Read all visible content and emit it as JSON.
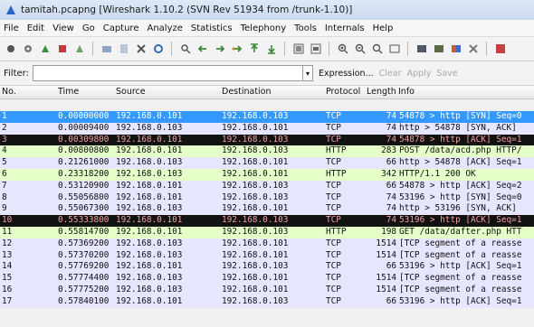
{
  "window": {
    "title": "tamitah.pcapng  [Wireshark 1.10.2  (SVN Rev 51934 from /trunk-1.10)]"
  },
  "menu": [
    "File",
    "Edit",
    "View",
    "Go",
    "Capture",
    "Analyze",
    "Statistics",
    "Telephony",
    "Tools",
    "Internals",
    "Help"
  ],
  "toolbar": {
    "icons": [
      "interface-list-icon",
      "capture-options-icon",
      "start-capture-icon",
      "stop-capture-icon",
      "restart-capture-icon",
      "open-file-icon",
      "save-file-icon",
      "close-file-icon",
      "reload-icon",
      "find-packet-icon",
      "go-back-icon",
      "go-forward-icon",
      "go-to-packet-icon",
      "go-first-icon",
      "go-last-icon",
      "colorize-icon",
      "auto-scroll-icon",
      "zoom-in-icon",
      "zoom-out-icon",
      "normal-size-icon",
      "resize-columns-icon",
      "capture-filters-icon",
      "display-filters-icon",
      "coloring-rules-icon",
      "preferences-icon",
      "help-icon"
    ]
  },
  "filter": {
    "label": "Filter:",
    "value": "",
    "expression": "Expression...",
    "clear": "Clear",
    "apply": "Apply",
    "save": "Save"
  },
  "columns": [
    "No.",
    "Time",
    "Source",
    "Destination",
    "Protocol",
    "Length",
    "Info"
  ],
  "colors": {
    "tcp": "#e7e6ff",
    "http": "#e4ffc7",
    "selected": "#3399ff",
    "dark": "#121212",
    "dark_text": "#f0a0a0"
  },
  "packets": [
    {
      "no": "1",
      "time": "0.00000000",
      "src": "192.168.0.101",
      "dst": "192.168.0.103",
      "proto": "TCP",
      "len": "74",
      "info": "54878 > http [SYN] Seq=0",
      "style": "selected"
    },
    {
      "no": "2",
      "time": "0.00009400",
      "src": "192.168.0.103",
      "dst": "192.168.0.101",
      "proto": "TCP",
      "len": "74",
      "info": "http > 54878 [SYN, ACK]",
      "style": "tcp"
    },
    {
      "no": "3",
      "time": "0.00309800",
      "src": "192.168.0.101",
      "dst": "192.168.0.103",
      "proto": "TCP",
      "len": "74",
      "info": "54878 > http [ACK] Seq=1",
      "style": "dark"
    },
    {
      "no": "4",
      "time": "0.00800800",
      "src": "192.168.0.101",
      "dst": "192.168.0.103",
      "proto": "HTTP",
      "len": "283",
      "info": "POST /data/acd.php HTTP/",
      "style": "http"
    },
    {
      "no": "5",
      "time": "0.21261000",
      "src": "192.168.0.103",
      "dst": "192.168.0.101",
      "proto": "TCP",
      "len": "66",
      "info": "http > 54878 [ACK] Seq=1",
      "style": "tcp"
    },
    {
      "no": "6",
      "time": "0.23318200",
      "src": "192.168.0.103",
      "dst": "192.168.0.101",
      "proto": "HTTP",
      "len": "342",
      "info": "HTTP/1.1 200 OK",
      "style": "http"
    },
    {
      "no": "7",
      "time": "0.53120900",
      "src": "192.168.0.101",
      "dst": "192.168.0.103",
      "proto": "TCP",
      "len": "66",
      "info": "54878 > http [ACK] Seq=2",
      "style": "tcp"
    },
    {
      "no": "8",
      "time": "0.55056800",
      "src": "192.168.0.101",
      "dst": "192.168.0.103",
      "proto": "TCP",
      "len": "74",
      "info": "53196 > http [SYN] Seq=0",
      "style": "tcp"
    },
    {
      "no": "9",
      "time": "0.55067300",
      "src": "192.168.0.103",
      "dst": "192.168.0.101",
      "proto": "TCP",
      "len": "74",
      "info": "http > 53196 [SYN, ACK]",
      "style": "tcp"
    },
    {
      "no": "10",
      "time": "0.55333800",
      "src": "192.168.0.101",
      "dst": "192.168.0.103",
      "proto": "TCP",
      "len": "74",
      "info": "53196 > http [ACK] Seq=1",
      "style": "dark"
    },
    {
      "no": "11",
      "time": "0.55814700",
      "src": "192.168.0.101",
      "dst": "192.168.0.103",
      "proto": "HTTP",
      "len": "198",
      "info": "GET /data/dafter.php HTT",
      "style": "http"
    },
    {
      "no": "12",
      "time": "0.57369200",
      "src": "192.168.0.103",
      "dst": "192.168.0.101",
      "proto": "TCP",
      "len": "1514",
      "info": "[TCP segment of a reasse",
      "style": "tcp"
    },
    {
      "no": "13",
      "time": "0.57370200",
      "src": "192.168.0.103",
      "dst": "192.168.0.101",
      "proto": "TCP",
      "len": "1514",
      "info": "[TCP segment of a reasse",
      "style": "tcp"
    },
    {
      "no": "14",
      "time": "0.57769200",
      "src": "192.168.0.101",
      "dst": "192.168.0.103",
      "proto": "TCP",
      "len": "66",
      "info": "53196 > http [ACK] Seq=1",
      "style": "tcp"
    },
    {
      "no": "15",
      "time": "0.57774400",
      "src": "192.168.0.103",
      "dst": "192.168.0.101",
      "proto": "TCP",
      "len": "1514",
      "info": "[TCP segment of a reasse",
      "style": "tcp"
    },
    {
      "no": "16",
      "time": "0.57775200",
      "src": "192.168.0.103",
      "dst": "192.168.0.101",
      "proto": "TCP",
      "len": "1514",
      "info": "[TCP segment of a reasse",
      "style": "tcp"
    },
    {
      "no": "17",
      "time": "0.57840100",
      "src": "192.168.0.101",
      "dst": "192.168.0.103",
      "proto": "TCP",
      "len": "66",
      "info": "53196 > http [ACK] Seq=1",
      "style": "tcp"
    }
  ]
}
